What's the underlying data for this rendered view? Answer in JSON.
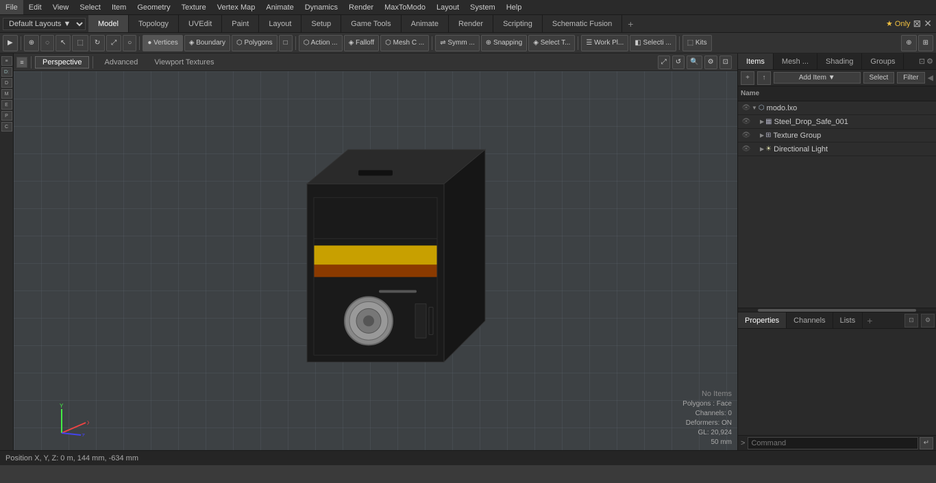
{
  "menu": {
    "items": [
      "File",
      "Edit",
      "View",
      "Select",
      "Item",
      "Geometry",
      "Texture",
      "Vertex Map",
      "Animate",
      "Dynamics",
      "Render",
      "MaxToModo",
      "Layout",
      "System",
      "Help"
    ]
  },
  "layout_select": "Default Layouts",
  "tabs": [
    {
      "label": "Model",
      "active": true
    },
    {
      "label": "Topology",
      "active": false
    },
    {
      "label": "UVEdit",
      "active": false
    },
    {
      "label": "Paint",
      "active": false
    },
    {
      "label": "Layout",
      "active": false
    },
    {
      "label": "Setup",
      "active": false
    },
    {
      "label": "Game Tools",
      "active": false
    },
    {
      "label": "Animate",
      "active": false
    },
    {
      "label": "Render",
      "active": false
    },
    {
      "label": "Scripting",
      "active": false
    },
    {
      "label": "Schematic Fusion",
      "active": false
    }
  ],
  "toolbar": {
    "buttons": [
      "▶",
      "⊕",
      "◌",
      "↖",
      "⬚",
      "⬡",
      "⬟",
      "○",
      "Vertices",
      "Boundary",
      "Polygons",
      "□",
      "⬡ Action ...",
      "Falloff",
      "Mesh C ...",
      "Symm ...",
      "Snapping",
      "Select T...",
      "Work Pl...",
      "Selecti ...",
      "Kits"
    ]
  },
  "viewport": {
    "view_label": "Perspective",
    "sub_tabs": [
      "Advanced",
      "Viewport Textures"
    ],
    "status": {
      "no_items": "No Items",
      "polygons": "Polygons : Face",
      "channels": "Channels: 0",
      "deformers": "Deformers: ON",
      "gl": "GL: 20,924",
      "size": "50 mm"
    },
    "position": "Position X, Y, Z:  0 m, 144 mm, -634 mm"
  },
  "right_panel": {
    "tabs": [
      "Items",
      "Mesh ...",
      "Shading",
      "Groups"
    ],
    "header": {
      "add_item_label": "Add Item",
      "select_label": "Select",
      "filter_label": "Filter"
    },
    "items_column_header": "Name",
    "items": [
      {
        "id": "modo_lxo",
        "label": "modo.lxo",
        "indent": 0,
        "type": "scene",
        "expanded": true
      },
      {
        "id": "steel_drop",
        "label": "Steel_Drop_Safe_001",
        "indent": 1,
        "type": "mesh",
        "expanded": false
      },
      {
        "id": "texture_group",
        "label": "Texture Group",
        "indent": 1,
        "type": "texture",
        "expanded": false
      },
      {
        "id": "dir_light",
        "label": "Directional Light",
        "indent": 1,
        "type": "light",
        "expanded": false
      }
    ]
  },
  "properties": {
    "tabs": [
      "Properties",
      "Channels",
      "Lists"
    ],
    "add_tab_label": "+"
  },
  "command_bar": {
    "prompt": ">",
    "placeholder": "Command",
    "run_icon": "↵"
  },
  "colors": {
    "accent": "#4a7a9b",
    "active_tab_bg": "#444444",
    "toolbar_bg": "#333333"
  }
}
